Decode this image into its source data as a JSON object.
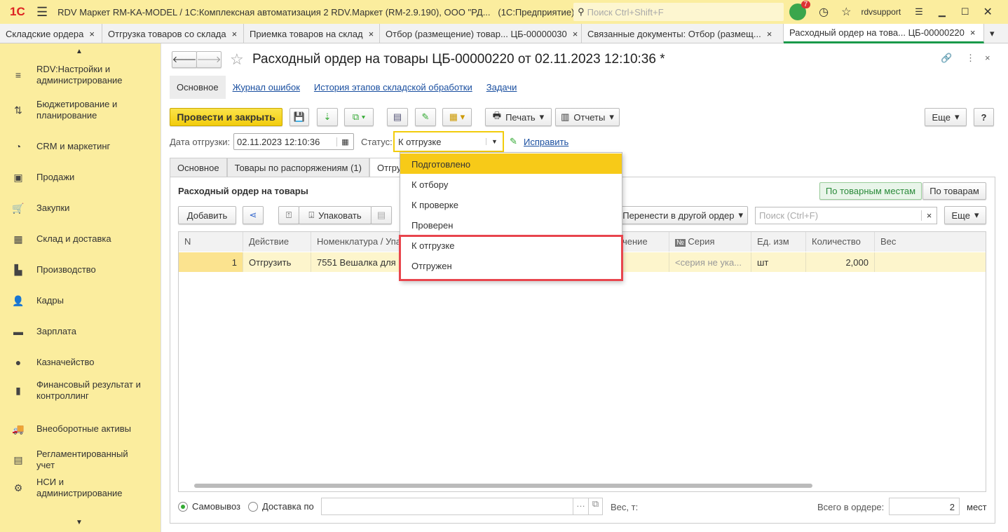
{
  "titlebar": {
    "logo": "1С",
    "title": "RDV Маркет RM-KA-MODEL / 1С:Комплексная автоматизация 2 RDV.Маркет (RM-2.9.190), ООО \"РД...   (1С:Предприятие)",
    "search_placeholder": "Поиск Ctrl+Shift+F",
    "notifications": "7",
    "user": "rdvsupport"
  },
  "tabs": [
    {
      "label": "Складские ордера"
    },
    {
      "label": "Отгрузка товаров со склада"
    },
    {
      "label": "Приемка товаров на склад"
    },
    {
      "label": "Отбор (размещение) товар... ЦБ-00000030"
    },
    {
      "label": "Связанные документы: Отбор (размещ..."
    },
    {
      "label": "Расходный ордер на това... ЦБ-00000220"
    }
  ],
  "sidebar": {
    "items": [
      {
        "label": "RDV:Настройки и администрирование",
        "icon": "≡"
      },
      {
        "label": "Бюджетирование и планирование",
        "icon": "⇅"
      },
      {
        "label": "CRM и маркетинг",
        "icon": "◔"
      },
      {
        "label": "Продажи",
        "icon": "▣"
      },
      {
        "label": "Закупки",
        "icon": "🛒"
      },
      {
        "label": "Склад и доставка",
        "icon": "▦"
      },
      {
        "label": "Производство",
        "icon": "▙"
      },
      {
        "label": "Кадры",
        "icon": "👤"
      },
      {
        "label": "Зарплата",
        "icon": "▬"
      },
      {
        "label": "Казначейство",
        "icon": "●"
      },
      {
        "label": "Финансовый результат и контроллинг",
        "icon": "▮"
      },
      {
        "label": "Внеоборотные активы",
        "icon": "🚚"
      },
      {
        "label": "Регламентированный учет",
        "icon": "▤"
      },
      {
        "label": "НСИ и администрирование",
        "icon": "⚙"
      }
    ]
  },
  "form": {
    "title": "Расходный ордер на товары ЦБ-00000220 от 02.11.2023 12:10:36 *",
    "nav": [
      "Основное",
      "Журнал ошибок",
      "История этапов складской обработки",
      "Задачи"
    ],
    "post_close": "Провести и закрыть",
    "print": "Печать",
    "reports": "Отчеты",
    "more": "Еще",
    "help": "?",
    "date_label": "Дата отгрузки:",
    "date_value": "02.11.2023 12:10:36",
    "status_label": "Статус:",
    "status_value": "К отгрузке",
    "fix": "Исправить",
    "inner_tabs": [
      "Основное",
      "Товары по распоряжениям (1)",
      "Отгру"
    ],
    "section_title": "Расходный ордер на товары",
    "view_places": "По товарным местам",
    "view_goods": "По товарам",
    "add": "Добавить",
    "pack": "Упаковать",
    "move": "Перенести в другой ордер",
    "search_placeholder": "Поиск (Ctrl+F)",
    "more2": "Еще",
    "columns": [
      "N",
      "Действие",
      "Номенклатура / Упа",
      "чение",
      "Серия",
      "Ед. изм",
      "Количество",
      "Вес"
    ],
    "row": {
      "n": "1",
      "action": "Отгрузить",
      "item": "7551 Вешалка для",
      "series": "<серия не ука...",
      "unit": "шт",
      "qty": "2,000"
    },
    "pickup": "Самовывоз",
    "delivery": "Доставка по",
    "weight": "Вес, т:",
    "total_label": "Всего в ордере:",
    "total": "2",
    "total_unit": "мест"
  },
  "dropdown": [
    "Подготовлено",
    "К отбору",
    "К проверке",
    "Проверен",
    "К отгрузке",
    "Отгружен"
  ]
}
